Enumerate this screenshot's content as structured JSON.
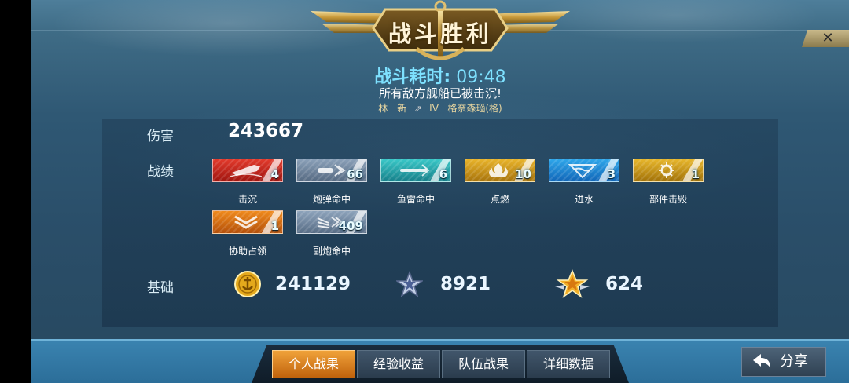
{
  "header": {
    "title": "战斗胜利",
    "close_label": "✕"
  },
  "battle": {
    "time_label": "战斗耗时:",
    "time_value": "09:48",
    "result_text": "所有敌方舰船已被击沉!",
    "player_name": "林一新",
    "ship_tier": "IV",
    "ship_name": "格奈森瑙(格)"
  },
  "damage": {
    "label": "伤害",
    "value": "243667"
  },
  "achievements": {
    "label": "战绩",
    "items": [
      {
        "icon": "sinking-ship-icon",
        "count": "4",
        "label": "击沉",
        "color": "#d12b20"
      },
      {
        "icon": "shell-hit-icon",
        "count": "66",
        "label": "炮弹命中",
        "color": "#6e849c"
      },
      {
        "icon": "torpedo-hit-icon",
        "count": "6",
        "label": "鱼雷命中",
        "color": "#2aa8ab"
      },
      {
        "icon": "fire-icon",
        "count": "10",
        "label": "点燃",
        "color": "#d59a1c"
      },
      {
        "icon": "flooding-icon",
        "count": "3",
        "label": "进水",
        "color": "#1f8ad6"
      },
      {
        "icon": "module-destroyed-icon",
        "count": "1",
        "label": "部件击毁",
        "color": "#d49d1b"
      },
      {
        "icon": "capture-assist-icon",
        "count": "1",
        "label": "协助占领",
        "color": "#e07415"
      },
      {
        "icon": "secondary-hit-icon",
        "count": "409",
        "label": "副炮命中",
        "color": "#7288a0"
      }
    ]
  },
  "base": {
    "label": "基础",
    "credits": "241129",
    "xp": "8921",
    "free_xp": "624"
  },
  "tabs": [
    "个人战果",
    "经验收益",
    "队伍战果",
    "详细数据"
  ],
  "share_label": "分享"
}
